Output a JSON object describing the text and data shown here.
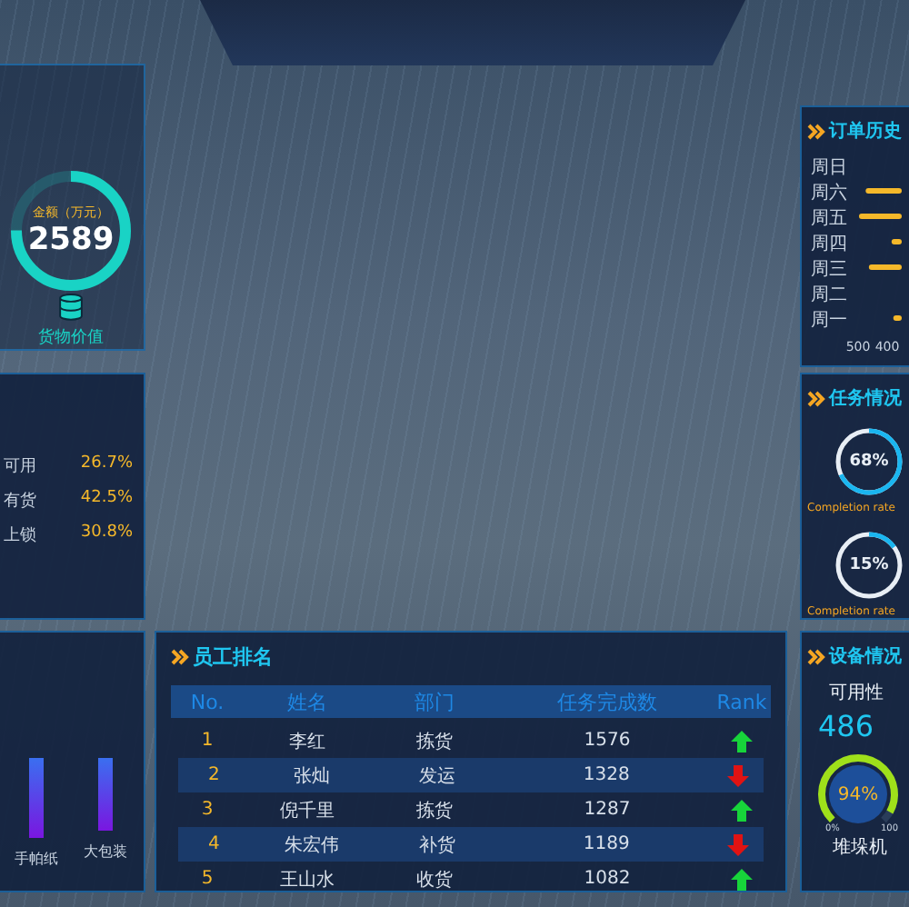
{
  "cargo_value": {
    "label": "金额（万元）",
    "value": "2589",
    "caption": "货物价值",
    "level": 0.75
  },
  "storage_status": {
    "rows": [
      {
        "label": "可用",
        "value": "26.7%"
      },
      {
        "label": "有货",
        "value": "42.5%"
      },
      {
        "label": "上锁",
        "value": "30.8%"
      }
    ]
  },
  "packaging": {
    "items": [
      {
        "label": "手帕纸"
      },
      {
        "label": "大包装"
      }
    ]
  },
  "employee_ranking": {
    "title": "员工排名",
    "columns": [
      "No.",
      "姓名",
      "部门",
      "任务完成数",
      "Rank"
    ],
    "rows": [
      {
        "no": "1",
        "name": "李红",
        "department": "拣货",
        "tasks": "1576",
        "kind": "up",
        "selected": false
      },
      {
        "no": "2",
        "name": "张灿",
        "department": "发运",
        "tasks": "1328",
        "kind": "down",
        "selected": true
      },
      {
        "no": "3",
        "name": "倪千里",
        "department": "拣货",
        "tasks": "1287",
        "kind": "up",
        "selected": false
      },
      {
        "no": "4",
        "name": "朱宏伟",
        "department": "补货",
        "tasks": "1189",
        "kind": "down",
        "selected": true
      },
      {
        "no": "5",
        "name": "王山水",
        "department": "收货",
        "tasks": "1082",
        "kind": "up",
        "selected": false
      }
    ]
  },
  "order_history": {
    "title": "订单历史",
    "chart_data": {
      "type": "bar",
      "orientation": "horizontal",
      "categories": [
        "周日",
        "周六",
        "周五",
        "周四",
        "周三",
        "周二",
        "周一"
      ],
      "series": [
        {
          "color": "#f5b82a",
          "values": [
            null,
            474,
            497,
            385,
            463,
            null,
            379
          ]
        }
      ],
      "xlim": [
        500,
        350
      ],
      "xticks": [
        500,
        400
      ]
    }
  },
  "task_status": {
    "title": "任务情况",
    "gauges": [
      {
        "value": "68%",
        "caption": "Completion rate",
        "level": 0.68
      },
      {
        "value": "15%",
        "caption": "Completion rate",
        "level": 0.15
      }
    ]
  },
  "equipment_status": {
    "title": "设备情况",
    "label": "可用性",
    "count": "486",
    "gauge": {
      "value": "94%",
      "level": 0.94,
      "min": "0%",
      "max": "100",
      "caption": "堆垛机"
    }
  }
}
